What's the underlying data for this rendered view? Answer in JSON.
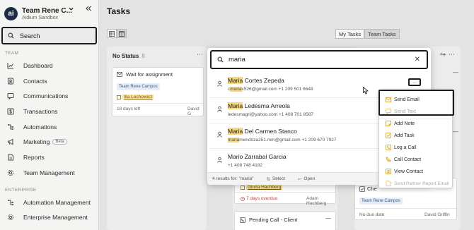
{
  "sidebar": {
    "team_name": "Team Rene C...",
    "team_sub": "Aidium Sandbox",
    "logo_text": "ai",
    "search_label": "Search",
    "team_section": "TEAM",
    "enterprise_section": "ENTERPRISE",
    "items": [
      {
        "label": "Dashboard",
        "icon": "chart-line-icon"
      },
      {
        "label": "Contacts",
        "icon": "contacts-icon"
      },
      {
        "label": "Communications",
        "icon": "chat-icon"
      },
      {
        "label": "Transactions",
        "icon": "dollar-icon"
      },
      {
        "label": "Automations",
        "icon": "automation-icon"
      },
      {
        "label": "Marketing",
        "icon": "megaphone-icon",
        "badge": "Beta"
      },
      {
        "label": "Reports",
        "icon": "reports-icon"
      },
      {
        "label": "Team Management",
        "icon": "gear-icon"
      }
    ],
    "enterprise_items": [
      {
        "label": "Automation Management",
        "icon": "automation-icon"
      },
      {
        "label": "Enterprise Management",
        "icon": "gear-icon"
      }
    ]
  },
  "main": {
    "title": "Tasks",
    "tabs": [
      {
        "label": "My Tasks",
        "active": false
      },
      {
        "label": "Team Tasks",
        "active": true
      }
    ],
    "columns": [
      {
        "name": "No Status",
        "count": "8",
        "card": {
          "title": "Wait for assignment",
          "tag": "Team Rene Campos",
          "link": "Ilia Lechowicz",
          "age": "18 days left",
          "assignee": "David G"
        }
      },
      {
        "card_a": {
          "link": "Gloria Hachberg",
          "due": "7 days overdue",
          "assignee": "Adam Hochberg"
        },
        "card_b": {
          "title": "Pending Call - Client"
        }
      },
      {
        "card": {
          "title": "Che",
          "tag": "Team Rene Campos",
          "due": "No due date",
          "assignee": "David Griffin"
        }
      }
    ]
  },
  "search": {
    "query": "maria",
    "results": [
      {
        "pre": "",
        "match": "Maria",
        "post": " Cortes Zepeda",
        "email_pre": "c",
        "email_match": "maria",
        "email_post": "x526@gmail.com",
        "phone": "+1 209 501 6648"
      },
      {
        "pre": "",
        "match": "Maria",
        "post": " Ledesma Arreola",
        "email_pre": "",
        "email_match": "",
        "email_post": "ledesmagri@yahoo.com",
        "phone": "+1 408 701 8587"
      },
      {
        "pre": "",
        "match": "Maria",
        "post": " Del Carmen Stanco",
        "email_pre": "",
        "email_match": "maria",
        "email_post": "mendoza251.mm@gmail.com",
        "phone": "+1 209 670 7927"
      },
      {
        "pre": "",
        "match": "",
        "post": "Mario Zarrabal Garcia",
        "email_pre": "",
        "email_match": "",
        "email_post": "",
        "phone": "+1 408 748 4182"
      }
    ],
    "more_label": "...",
    "footer": {
      "results": "4 results for: \"maria\"",
      "select": "Select",
      "open": "Open",
      "select_key": "⇅",
      "open_key": "↩"
    }
  },
  "context_menu": {
    "items": [
      {
        "label": "Send Email",
        "icon": "email-icon",
        "disabled": false
      },
      {
        "label": "Send Text",
        "icon": "chat-icon",
        "disabled": true
      },
      {
        "label": "Add Note",
        "icon": "note-icon",
        "disabled": false
      },
      {
        "label": "Add Task",
        "icon": "task-icon",
        "disabled": false
      },
      {
        "label": "Log a Call",
        "icon": "call-log-icon",
        "disabled": false
      },
      {
        "label": "Call Contact",
        "icon": "phone-icon",
        "disabled": false
      },
      {
        "label": "View Contact",
        "icon": "contact-card-icon",
        "disabled": false
      },
      {
        "label": "Send Partner Report Email",
        "icon": "report-email-icon",
        "disabled": true
      }
    ]
  },
  "colors": {
    "accent": "#e2a520",
    "highlight": "#f5d97a",
    "text": "#2b2b2b"
  }
}
